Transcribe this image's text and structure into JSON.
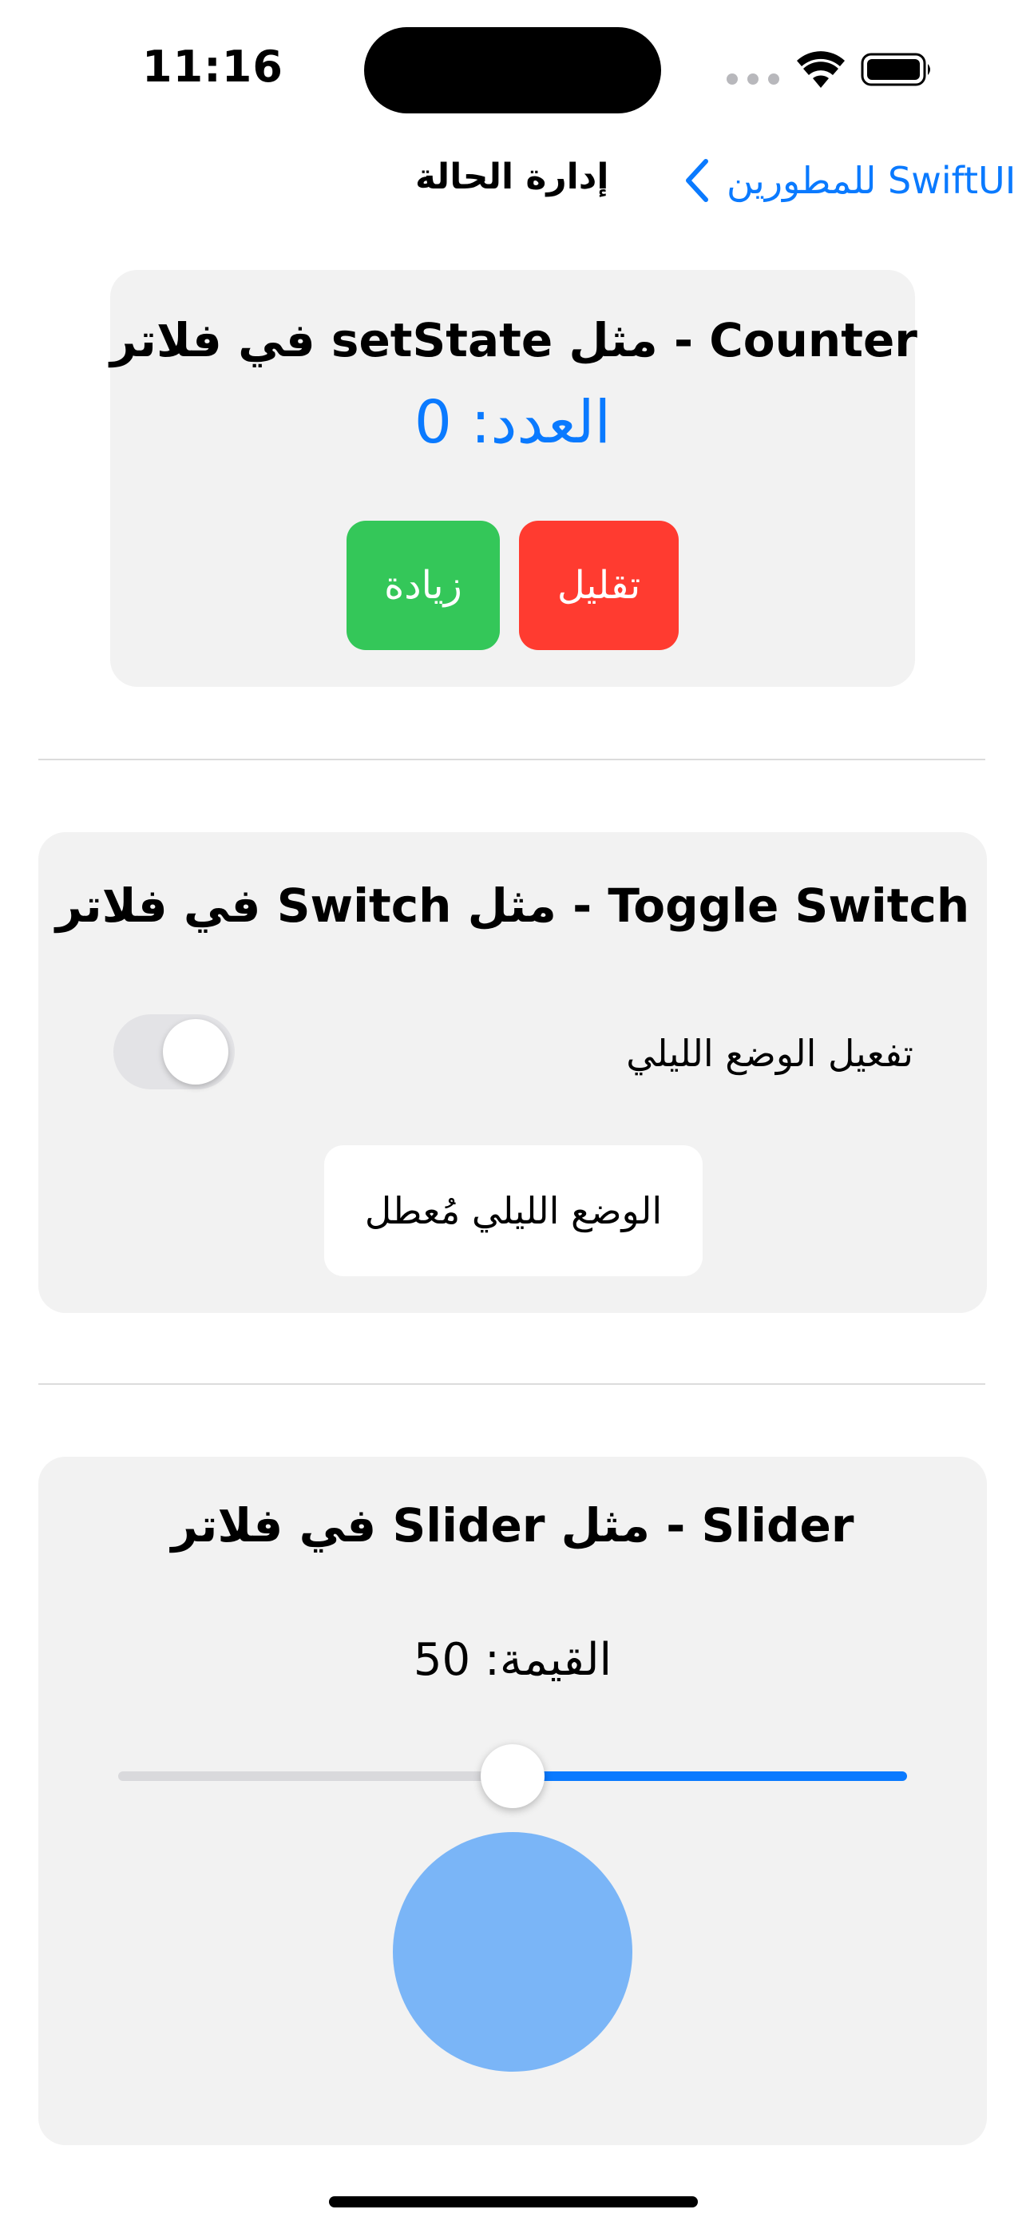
{
  "status_bar": {
    "time": "11:16"
  },
  "nav": {
    "back_label": "للمطورين SwiftUI",
    "title": "إدارة الحالة"
  },
  "counter_card": {
    "title": "في فلاتر setState مثل - Counter",
    "count_text": "العدد: 0",
    "count": 0,
    "decrement_label": "تقليل",
    "increment_label": "زيادة"
  },
  "toggle_card": {
    "title": "في فلاتر Switch مثل - Toggle Switch",
    "toggle_label": "تفعيل الوضع الليلي",
    "toggle_on": false,
    "status_text": "الوضع الليلي مُعطل"
  },
  "slider_card": {
    "title": "في فلاتر Slider مثل - Slider",
    "value_text": "القيمة: 50",
    "value": 50
  },
  "colors": {
    "accent": "#0a7aff",
    "decrement": "#ff3b30",
    "increment": "#34c759",
    "card_bg": "#f2f2f2",
    "circle": "#7ab5f7"
  },
  "icons": {
    "back": "chevron-left-icon",
    "signal": "cellular-dots-icon",
    "wifi": "wifi-icon",
    "battery": "battery-icon"
  }
}
